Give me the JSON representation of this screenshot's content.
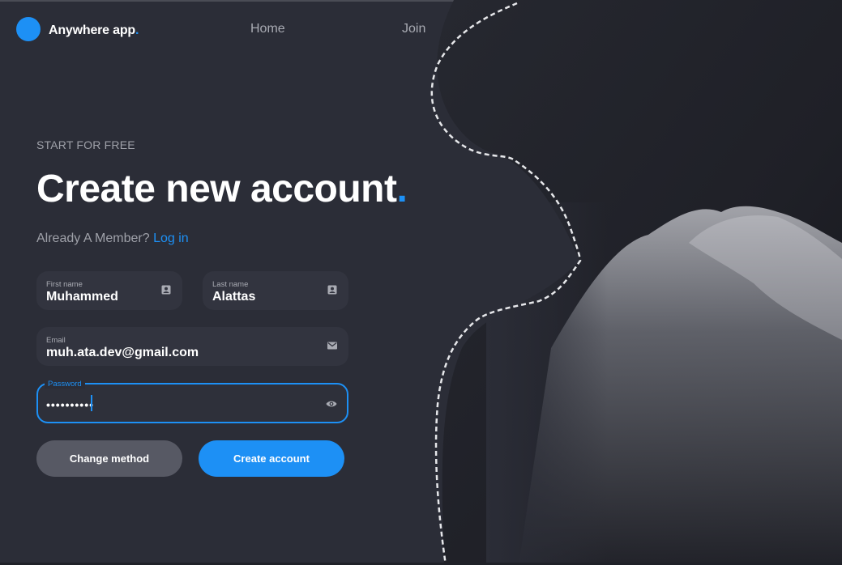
{
  "brand": {
    "name": "Anywhere app",
    "dot": ".",
    "accent_color": "#1d90f5"
  },
  "nav": {
    "home": "Home",
    "join": "Join"
  },
  "hero": {
    "eyebrow": "START FOR FREE",
    "title": "Create new account",
    "title_dot": ".",
    "member_text": "Already A Member?",
    "login_link": "Log in"
  },
  "form": {
    "first_name": {
      "label": "First name",
      "value": "Muhammed",
      "icon": "contact-card-icon"
    },
    "last_name": {
      "label": "Last name",
      "value": "Alattas",
      "icon": "contact-card-icon"
    },
    "email": {
      "label": "Email",
      "value": "muh.ata.dev@gmail.com",
      "icon": "mail-icon"
    },
    "password": {
      "label": "Password",
      "value": "••••••••••",
      "icon": "eye-icon"
    }
  },
  "buttons": {
    "change_method": "Change method",
    "create_account": "Create account"
  }
}
